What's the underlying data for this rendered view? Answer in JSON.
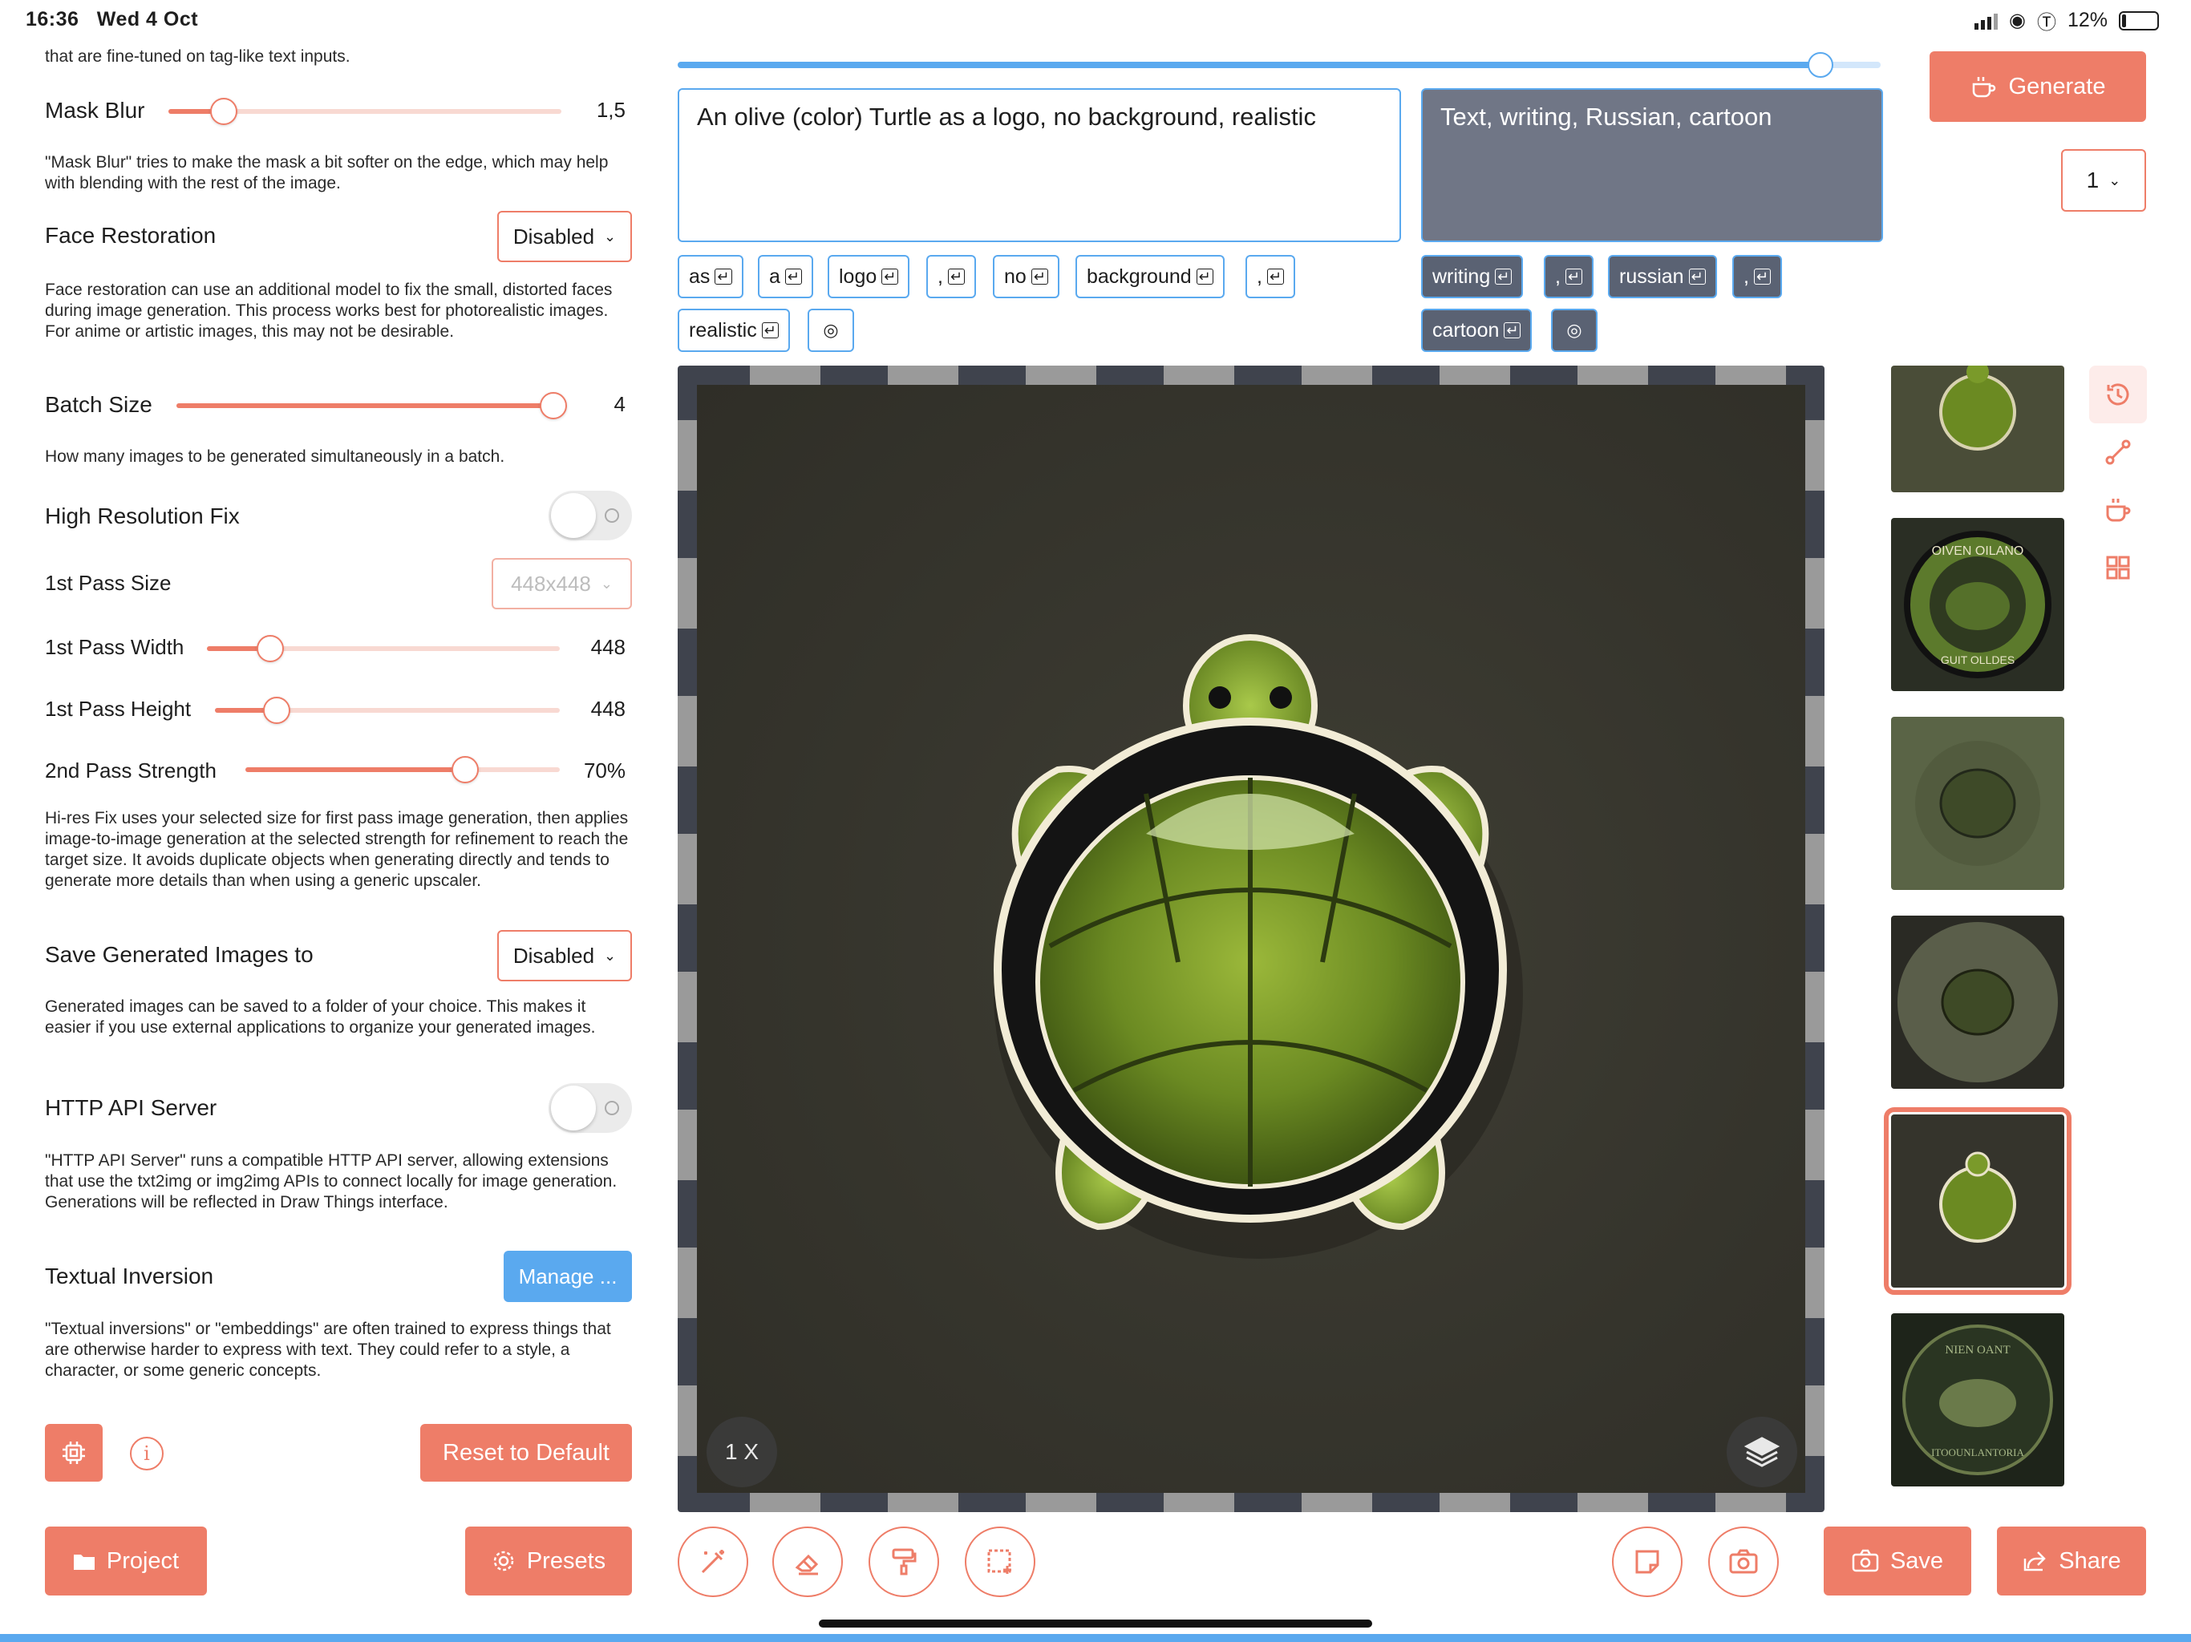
{
  "status_bar": {
    "time": "16:36",
    "date": "Wed 4 Oct",
    "battery": "12%"
  },
  "left_panel": {
    "top_text": "that are fine-tuned on tag-like text inputs.",
    "mask_blur": {
      "label": "Mask Blur",
      "value": "1,5",
      "level": 0.14,
      "desc": "\"Mask Blur\" tries to make the mask a bit softer on the edge, which may help with blending with the rest of the image."
    },
    "face_restoration": {
      "label": "Face Restoration",
      "selected": "Disabled",
      "desc": "Face restoration can use an additional model to fix the small, distorted faces during image generation. This process works best for photorealistic images. For anime or artistic images, this may not be desirable."
    },
    "batch_size": {
      "label": "Batch Size",
      "value": "4",
      "level": 1.0,
      "desc": "How many images to be generated simultaneously in a batch."
    },
    "hires_fix": {
      "label": "High Resolution Fix",
      "enabled": false
    },
    "first_pass_size": {
      "label": "1st Pass Size",
      "selected": "448x448"
    },
    "first_pass_width": {
      "label": "1st Pass Width",
      "value": "448",
      "level": 0.18
    },
    "first_pass_height": {
      "label": "1st Pass Height",
      "value": "448",
      "level": 0.18
    },
    "second_pass_strength": {
      "label": "2nd Pass Strength",
      "value": "70%",
      "level": 0.7
    },
    "hires_desc": "Hi-res Fix uses your selected size for first pass image generation, then applies image-to-image generation at the selected strength for refinement to reach the target size. It avoids duplicate objects when generating directly and tends to generate more details than when using a generic upscaler.",
    "save_images": {
      "label": "Save Generated Images to",
      "selected": "Disabled",
      "desc": "Generated images can be saved to a folder of your choice. This makes it easier if you use external applications to organize your generated images."
    },
    "http_api": {
      "label": "HTTP API Server",
      "enabled": false,
      "desc": "\"HTTP API Server\" runs a compatible HTTP API server, allowing extensions that use the txt2img or img2img APIs to connect locally for image generation. Generations will be reflected in Draw Things interface."
    },
    "textual_inversion": {
      "label": "Textual Inversion",
      "button": "Manage ...",
      "desc": "\"Textual inversions\" or \"embeddings\" are often trained to express things that are otherwise harder to express with text. They could refer to a style, a character, or some generic concepts."
    },
    "reset_button": "Reset to Default",
    "project_button": "Project",
    "presets_button": "Presets"
  },
  "generation": {
    "progress": 0.95,
    "generate_button": "Generate",
    "count": "1"
  },
  "prompt": {
    "positive": "An olive (color) Turtle as a logo, no background, realistic",
    "negative": "Text, writing, Russian, cartoon",
    "positive_chips": [
      "as",
      "a",
      "logo",
      ",",
      "no",
      "background",
      ",",
      "realistic"
    ],
    "negative_chips": [
      "writing",
      ",",
      "russian",
      ",",
      "cartoon"
    ]
  },
  "canvas": {
    "zoom": "1 X"
  },
  "thumbnails": {
    "thumb_2_text_top": "OIVEN OILANO",
    "thumb_2_text_bottom": "GUIT OLLDES",
    "thumb_6_text_top": "NIEN OANT",
    "thumb_6_text_bottom": "ITOOUNLANTORIA"
  },
  "bottom_bar": {
    "save_button": "Save",
    "share_button": "Share"
  },
  "colors": {
    "accent": "#ee7d68",
    "blue": "#5aa9ef",
    "negative_prompt_bg": "#707686",
    "canvas_bg": "#35342c"
  }
}
